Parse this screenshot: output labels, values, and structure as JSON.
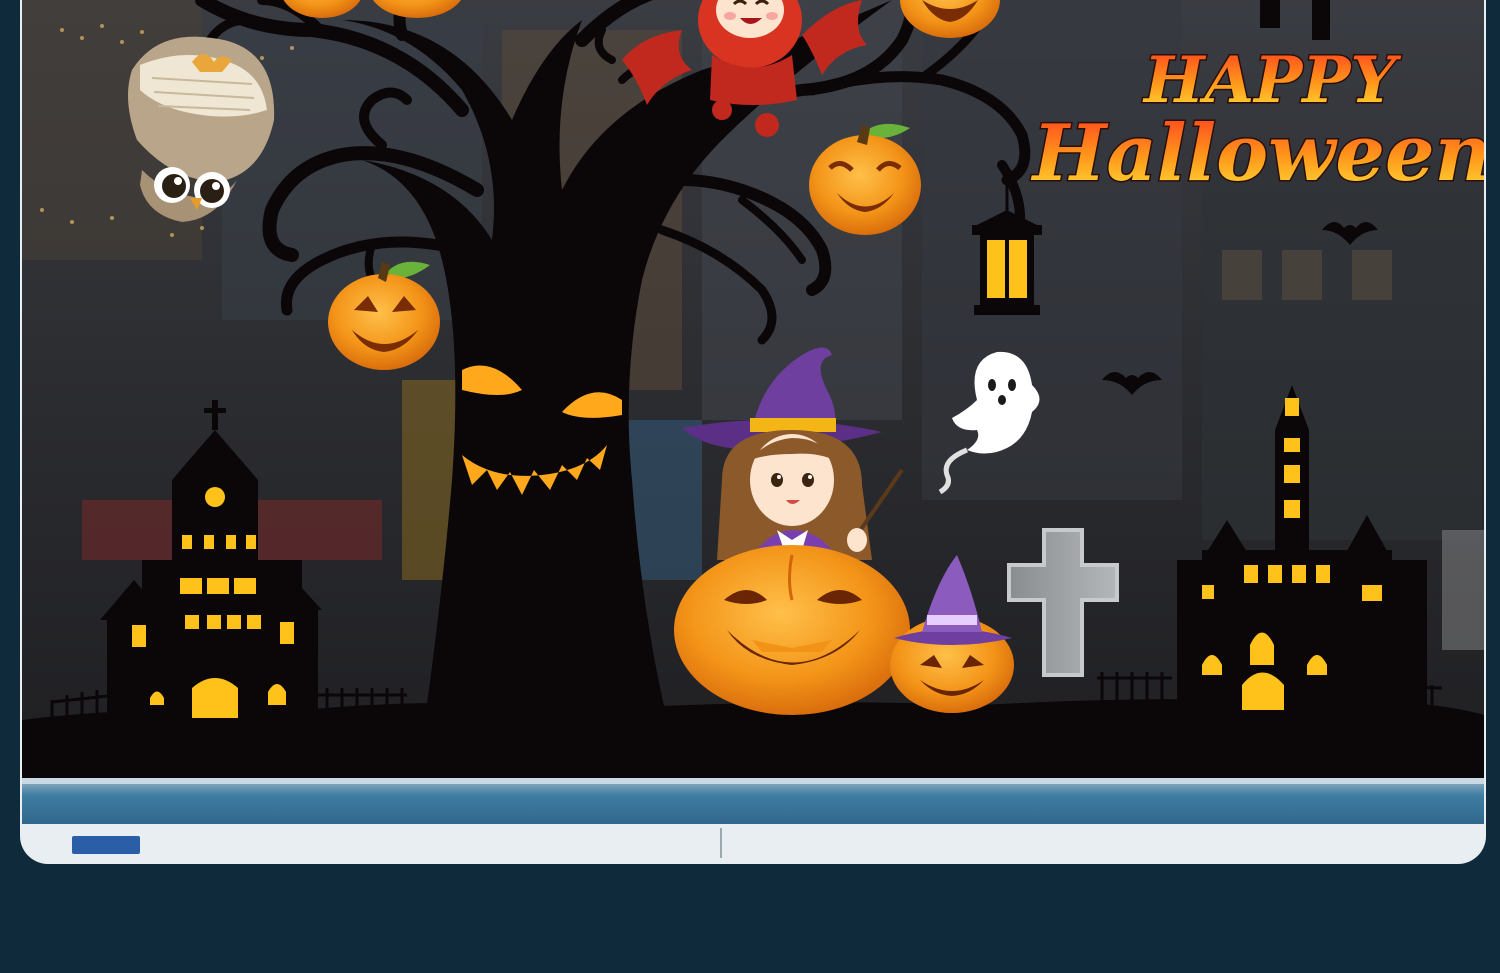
{
  "image": {
    "title_line1": "HAPPY",
    "title_line2": "Halloween"
  },
  "colors": {
    "background_navy": "#0f2b3b",
    "frame_white": "#f3f6f8",
    "silhouette": "#0b0608",
    "pumpkin_orange": "#f29216",
    "glow_yellow": "#ffc21a",
    "witch_purple": "#6f3fa0",
    "sill_blue": "#2e6d94",
    "title_red": "#e0361c",
    "title_yellow": "#ffe23a"
  }
}
